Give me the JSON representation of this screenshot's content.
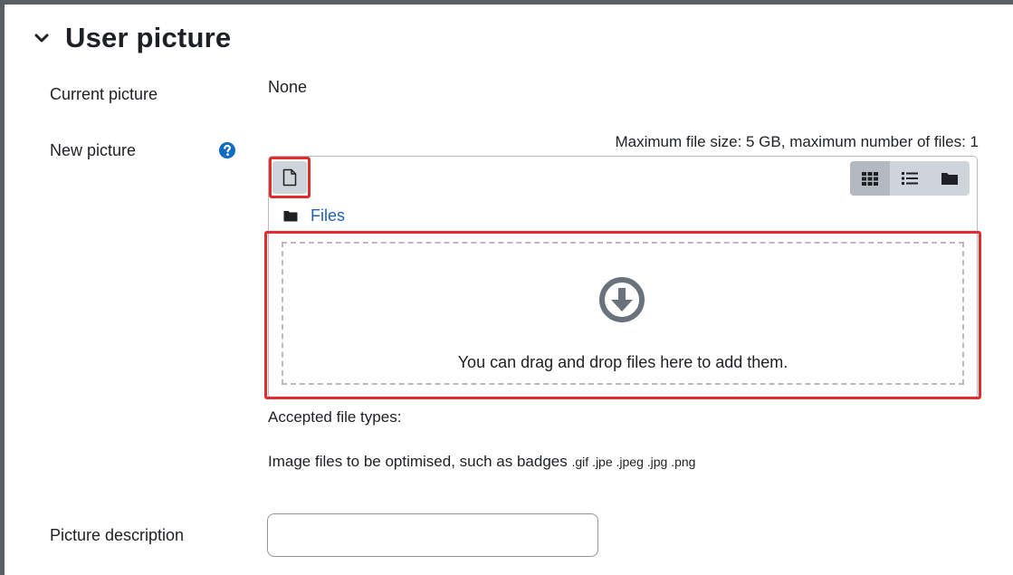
{
  "section": {
    "title": "User picture",
    "icons": {
      "collapse": "chevron-down-icon"
    }
  },
  "fields": {
    "current_picture": {
      "label": "Current picture",
      "value": "None"
    },
    "new_picture": {
      "label": "New picture",
      "help_icon": "question-circle-icon",
      "max_info": "Maximum file size: 5 GB, maximum number of files: 1",
      "add_icon": "file-add-icon",
      "view_buttons": [
        "grid-view-icon",
        "list-view-icon",
        "tree-view-icon"
      ],
      "path": {
        "folder_icon": "folder-icon",
        "link": "Files"
      },
      "dropzone": {
        "icon": "download-arrow-circle-icon",
        "text": "You can drag and drop files here to add them."
      },
      "accepted_label": "Accepted file types:",
      "accepted_desc": "Image files to be optimised, such as badges",
      "accepted_ext": ".gif .jpe .jpeg .jpg .png"
    },
    "picture_description": {
      "label": "Picture description",
      "value": ""
    }
  },
  "colors": {
    "highlight": "#e02c2c",
    "link": "#1f62b4",
    "help": "#0f6cbf"
  }
}
